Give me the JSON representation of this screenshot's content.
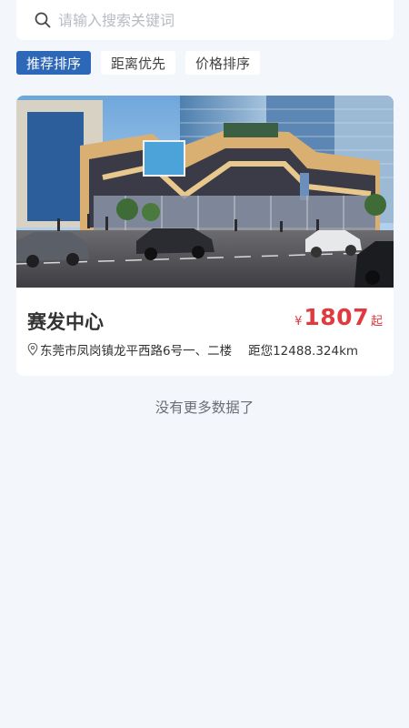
{
  "search": {
    "placeholder": "请输入搜索关键词",
    "value": "",
    "icon": "search-icon"
  },
  "sort_tabs": [
    {
      "label": "推荐排序",
      "active": true
    },
    {
      "label": "距离优先",
      "active": false
    },
    {
      "label": "价格排序",
      "active": false
    }
  ],
  "listings": [
    {
      "title": "赛发中心",
      "price_currency": "¥",
      "price": "1807",
      "price_suffix": "起",
      "address": "东莞市凤岗镇龙平西路6号一、二楼",
      "distance": "距您12488.324km",
      "image": "building-photo"
    }
  ],
  "footer": {
    "no_more": "没有更多数据了"
  },
  "colors": {
    "background": "#f3f6fa",
    "accent": "#2c67b8",
    "price": "#e0393e"
  }
}
